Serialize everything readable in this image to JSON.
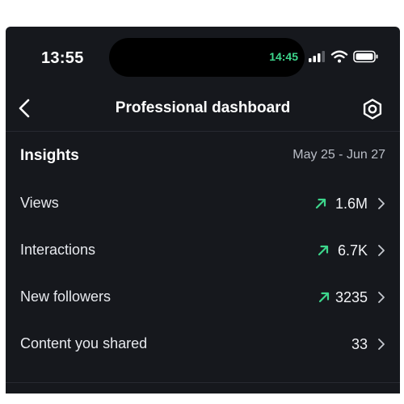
{
  "status_bar": {
    "time": "13:55",
    "island_time": "14:45",
    "icons": [
      "signal-icon",
      "wifi-icon",
      "battery-icon"
    ]
  },
  "nav": {
    "title": "Professional dashboard",
    "back_icon": "chevron-left-icon",
    "settings_icon": "gear-icon"
  },
  "insights": {
    "title": "Insights",
    "date_range": "May 25 - Jun 27"
  },
  "metrics": [
    {
      "label": "Views",
      "value": "1.6M",
      "trend": "up"
    },
    {
      "label": "Interactions",
      "value": "6.7K",
      "trend": "up"
    },
    {
      "label": "New followers",
      "value": "3235",
      "trend": "up"
    },
    {
      "label": "Content you shared",
      "value": "33",
      "trend": "none"
    }
  ],
  "colors": {
    "background": "#16181d",
    "accent_green": "#3dd68c",
    "text_primary": "#ffffff",
    "text_secondary": "#b9bdc6"
  }
}
